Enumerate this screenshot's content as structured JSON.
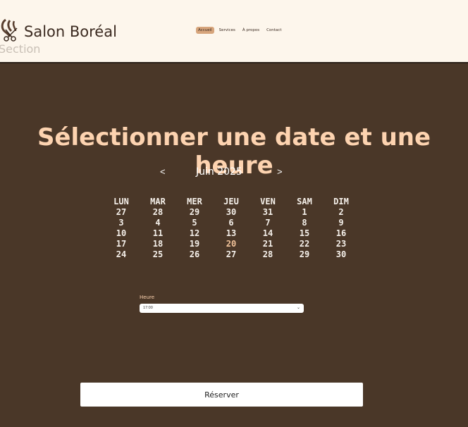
{
  "header": {
    "brand": "Salon Boréal",
    "section_ghost": "Section",
    "nav": [
      {
        "label": "Accueil",
        "active": true
      },
      {
        "label": "Services",
        "active": false
      },
      {
        "label": "À propos",
        "active": false
      },
      {
        "label": "Contact",
        "active": false
      }
    ],
    "logo_icon": "scissors-hair-icon"
  },
  "main": {
    "title": "Sélectionner une date et une heure",
    "calendar": {
      "prev": "<",
      "month": "Juin 2025",
      "next": ">",
      "weekdays": [
        "LUN",
        "MAR",
        "MER",
        "JEU",
        "VEN",
        "SAM",
        "DIM"
      ],
      "weeks": [
        [
          "27",
          "28",
          "29",
          "30",
          "31",
          "1",
          "2"
        ],
        [
          "3",
          "4",
          "5",
          "6",
          "7",
          "8",
          "9"
        ],
        [
          "10",
          "11",
          "12",
          "13",
          "14",
          "15",
          "16"
        ],
        [
          "17",
          "18",
          "19",
          "20",
          "21",
          "22",
          "23"
        ],
        [
          "24",
          "25",
          "26",
          "27",
          "28",
          "29",
          "30"
        ]
      ],
      "highlighted": "20"
    },
    "time": {
      "label": "Heure",
      "value": "17:00",
      "chevron": "chevron-down-icon"
    },
    "submit": "Réserver"
  },
  "colors": {
    "background": "#4a3728",
    "header_bg": "#fdf6ec",
    "title": "#fdd3b0",
    "nav_active": "#d7a57c",
    "highlight_day": "#f2c39a"
  }
}
